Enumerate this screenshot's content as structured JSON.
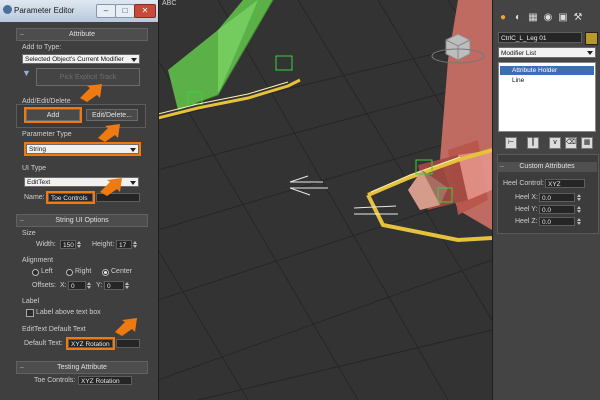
{
  "menubar": {
    "fragment": "ABC"
  },
  "parameter_editor": {
    "title": "Parameter Editor",
    "attribute_rollout": "Attribute",
    "add_to_type_label": "Add to Type:",
    "add_to_type_value": "Selected Object's Current Modifier",
    "pick_button_label": "Pick Explicit Track",
    "add_edit_delete_label": "Add/Edit/Delete",
    "add_button": "Add",
    "edit_delete_button": "Edit/Delete...",
    "parameter_type_label": "Parameter Type",
    "parameter_type_value": "String",
    "ui_type_label": "UI Type",
    "ui_type_value": "EditText",
    "name_label": "Name:",
    "name_value": "Toe Controls",
    "string_ui_options_rollout": "String UI Options",
    "size_label": "Size",
    "width_label": "Width:",
    "width_value": "150",
    "height_label": "Height:",
    "height_value": "17",
    "alignment_label": "Alignment",
    "align_left": "Left",
    "align_right": "Right",
    "align_center": "Center",
    "alignment_selected": "Center",
    "offsets_label": "Offsets:",
    "offset_x_label": "X:",
    "offset_x_value": "0",
    "offset_y_label": "Y:",
    "offset_y_value": "0",
    "label_group": "Label",
    "label_above_text": "Label above text box",
    "label_above_checked": false,
    "edittext_default_label": "EditText Default Text",
    "default_text_label": "Default Text:",
    "default_text_value": "XYZ Rotation",
    "testing_rollout": "Testing Attribute",
    "toe_controls_label": "Toe Controls:",
    "toe_controls_value": "XYZ Rotation"
  },
  "command_panel": {
    "object_name": "CtrlC_L_Leg 01",
    "modifier_list": "Modifier List",
    "stack_items": [
      {
        "label": "Attribute Holder",
        "selected": true
      },
      {
        "label": "Line",
        "selected": false
      }
    ],
    "custom_attributes_rollout": "Custom Attributes",
    "heel_control_label": "Heel Control:",
    "heel_control_value": "XYZ",
    "heel_x_label": "Heel X:",
    "heel_x_value": "0.0",
    "heel_y_label": "Heel Y:",
    "heel_y_value": "0.0",
    "heel_z_label": "Heel Z:",
    "heel_z_value": "0.0"
  },
  "colors": {
    "highlight": "#f07a12",
    "selection": "#3a6fb6",
    "green_mesh": "#5fbf4a",
    "red_mesh": "#d9756a",
    "yellow_path": "#e6c23c"
  }
}
